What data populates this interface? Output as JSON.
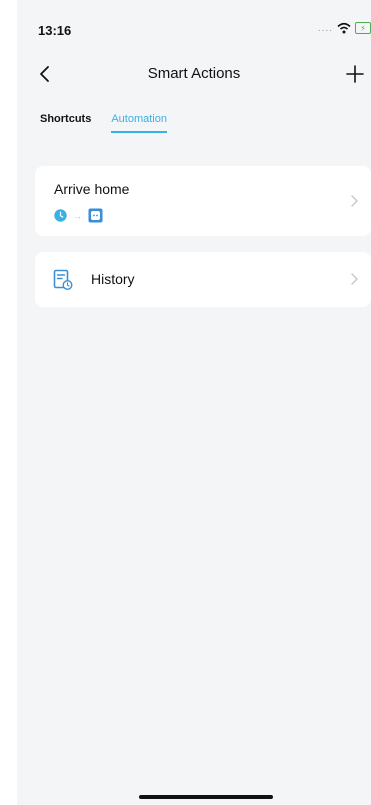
{
  "status_bar": {
    "time": "13:16",
    "signal": "....",
    "icons": [
      "wifi-icon",
      "battery-charging-icon"
    ],
    "battery_glyph": "⚡"
  },
  "nav": {
    "back_icon": "chevron-left-icon",
    "title": "Smart Actions",
    "add_icon": "plus-icon"
  },
  "tabs": [
    {
      "label": "Shortcuts",
      "active": false
    },
    {
      "label": "Automation",
      "active": true
    }
  ],
  "automations": [
    {
      "title": "Arrive home",
      "trigger_icon": "clock-icon",
      "arrow": "→",
      "action_icon": "smart-plug-icon"
    }
  ],
  "history": {
    "label": "History",
    "icon": "history-document-icon"
  },
  "colors": {
    "accent": "#3ab0e8",
    "background": "#f4f5f7",
    "card": "#ffffff",
    "text": "#111111",
    "chevron": "#c4c7cc",
    "battery": "#4cb050"
  }
}
